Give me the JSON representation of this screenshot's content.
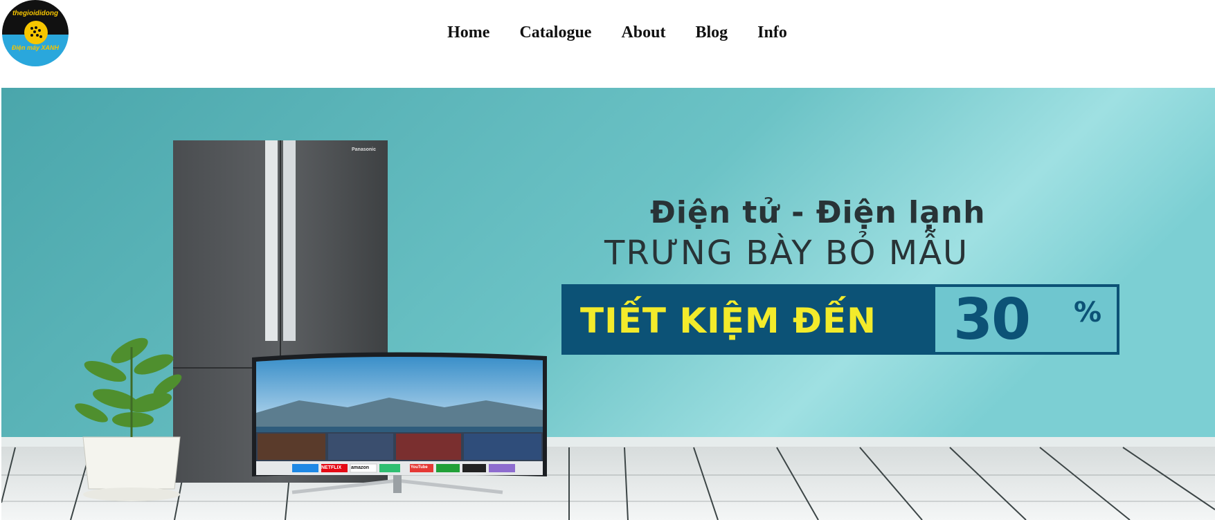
{
  "logo": {
    "top_text": "thegioididong",
    "bottom_text": "Điện máy XANH"
  },
  "nav": {
    "items": [
      "Home",
      "Catalogue",
      "About",
      "Blog",
      "Info"
    ]
  },
  "banner": {
    "headline1": "Điện tử - Điện lạnh",
    "headline2": "TRƯNG BÀY BỎ MẪU",
    "promo_text": "TIẾT KIỆM ĐẾN",
    "promo_value": "30",
    "promo_unit": "%",
    "fridge_brand": "Panasonic",
    "tv_apps": [
      "NETFLIX",
      "amazon",
      "YouTube"
    ]
  },
  "colors": {
    "wall": "#62b7bb",
    "promo_bg": "#0c5276",
    "promo_text": "#f3eb2b",
    "headline": "#283336"
  }
}
